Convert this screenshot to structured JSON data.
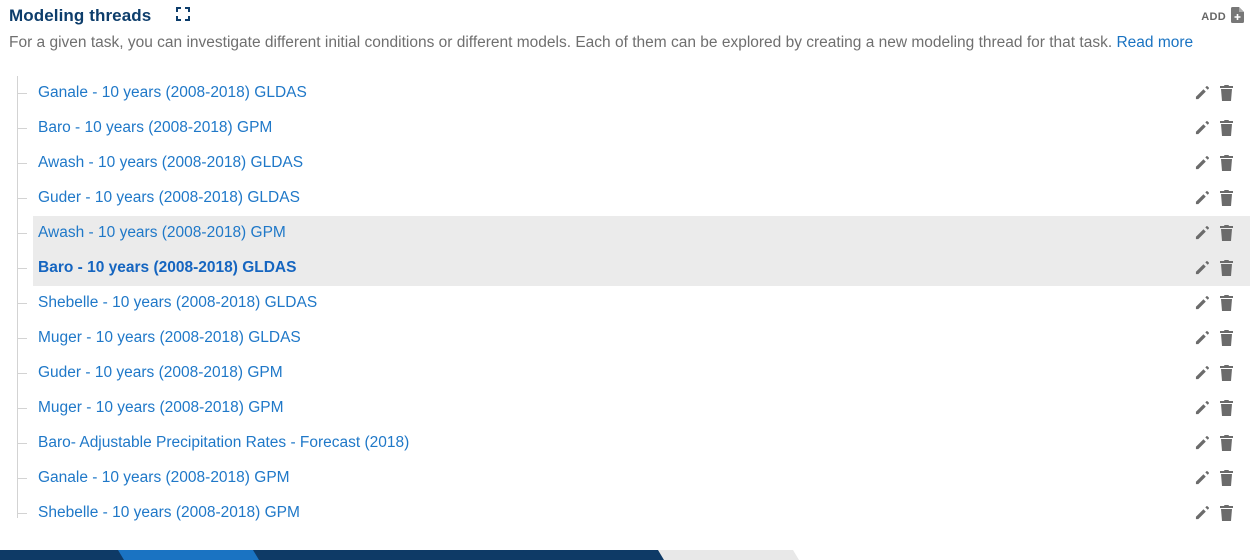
{
  "header": {
    "title": "Modeling threads",
    "add_label": "ADD"
  },
  "description": {
    "text": "For a given task, you can investigate different initial conditions or different models. Each of them can be explored by creating a new modeling thread for that task.",
    "link": "Read more"
  },
  "threads": [
    {
      "label": "Ganale - 10 years (2008-2018) GLDAS"
    },
    {
      "label": "Baro - 10 years (2008-2018) GPM"
    },
    {
      "label": "Awash - 10 years (2008-2018) GLDAS"
    },
    {
      "label": "Guder - 10 years (2008-2018) GLDAS"
    },
    {
      "label": "Awash - 10 years (2008-2018) GPM"
    },
    {
      "label": "Baro - 10 years (2008-2018) GLDAS"
    },
    {
      "label": "Shebelle - 10 years (2008-2018) GLDAS"
    },
    {
      "label": "Muger - 10 years (2008-2018) GLDAS"
    },
    {
      "label": "Guder - 10 years (2008-2018) GPM"
    },
    {
      "label": "Muger - 10 years (2008-2018) GPM"
    },
    {
      "label": "Baro- Adjustable Precipitation Rates - Forecast (2018)"
    },
    {
      "label": "Ganale - 10 years (2008-2018) GPM"
    },
    {
      "label": "Shebelle - 10 years (2008-2018) GPM"
    }
  ],
  "highlighted_rows": [
    4,
    5
  ],
  "active_row": 5,
  "colors": {
    "title": "#0d3d6b",
    "link": "#1f78c8",
    "highlight_bg": "#ebebeb",
    "icon": "#6b6b6b",
    "tab_dark": "#0e3a66",
    "tab_active": "#1a73c2",
    "tab_light": "#e8e8e8"
  },
  "tab_states": [
    "dark",
    "active",
    "dark",
    "dark",
    "dark",
    "light"
  ]
}
